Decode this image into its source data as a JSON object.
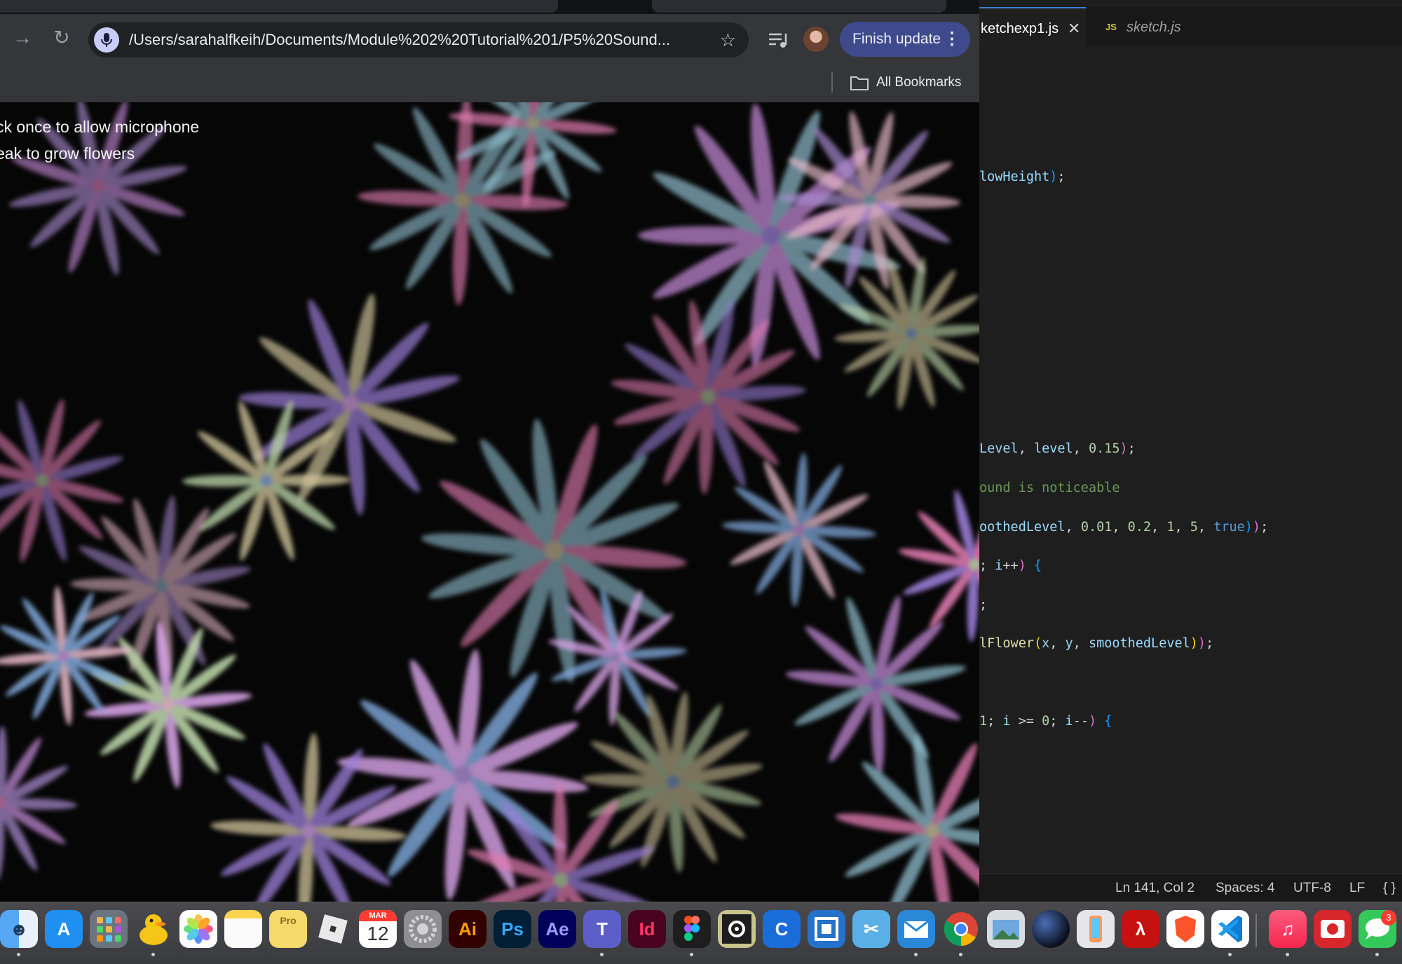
{
  "browser": {
    "url": "/Users/sarahalfkeih/Documents/Module%202%20Tutorial%201/P5%20Sound...",
    "finish_update_label": "Finish update",
    "bookmarks_label": "All Bookmarks",
    "canvas_lines": [
      "ck once to allow microphone",
      "eak to grow flowers"
    ],
    "icons": {
      "forward": "arrow-right-icon",
      "reload": "reload-icon",
      "mic": "microphone-icon",
      "star": "star-icon",
      "media": "media-controls-icon",
      "more": "more-vertical-icon",
      "folder": "folder-icon"
    },
    "accent_color": "#3e4a8c"
  },
  "editor": {
    "tabs": [
      {
        "label": "ketchexp1.js",
        "active": true
      },
      {
        "label": "sketch.js",
        "active": false,
        "badge": "JS"
      }
    ],
    "status": {
      "position": "Ln 141, Col 2",
      "spaces": "Spaces: 4",
      "encoding": "UTF-8",
      "eol": "LF",
      "language_icon": "{ }"
    }
  },
  "dock": {
    "apps": [
      "Finder",
      "App Store",
      "Launchpad",
      "Cyberduck",
      "Photos",
      "Notes",
      "Notes Pro",
      "Roblox",
      "Calendar",
      "System Settings",
      "Illustrator",
      "Photoshop",
      "After Effects",
      "Teams",
      "InDesign",
      "Figma",
      "Capture",
      "Canva",
      "Screenshot Tool",
      "Scissors",
      "Outlook",
      "Chrome",
      "Preview",
      "Cinema 4D",
      "Simulator",
      "Acrobat",
      "Brave",
      "VS Code",
      "Music",
      "Photo Booth",
      "Messages"
    ],
    "calendar_month": "MAR",
    "calendar_day": "12",
    "messages_badge": "3"
  }
}
